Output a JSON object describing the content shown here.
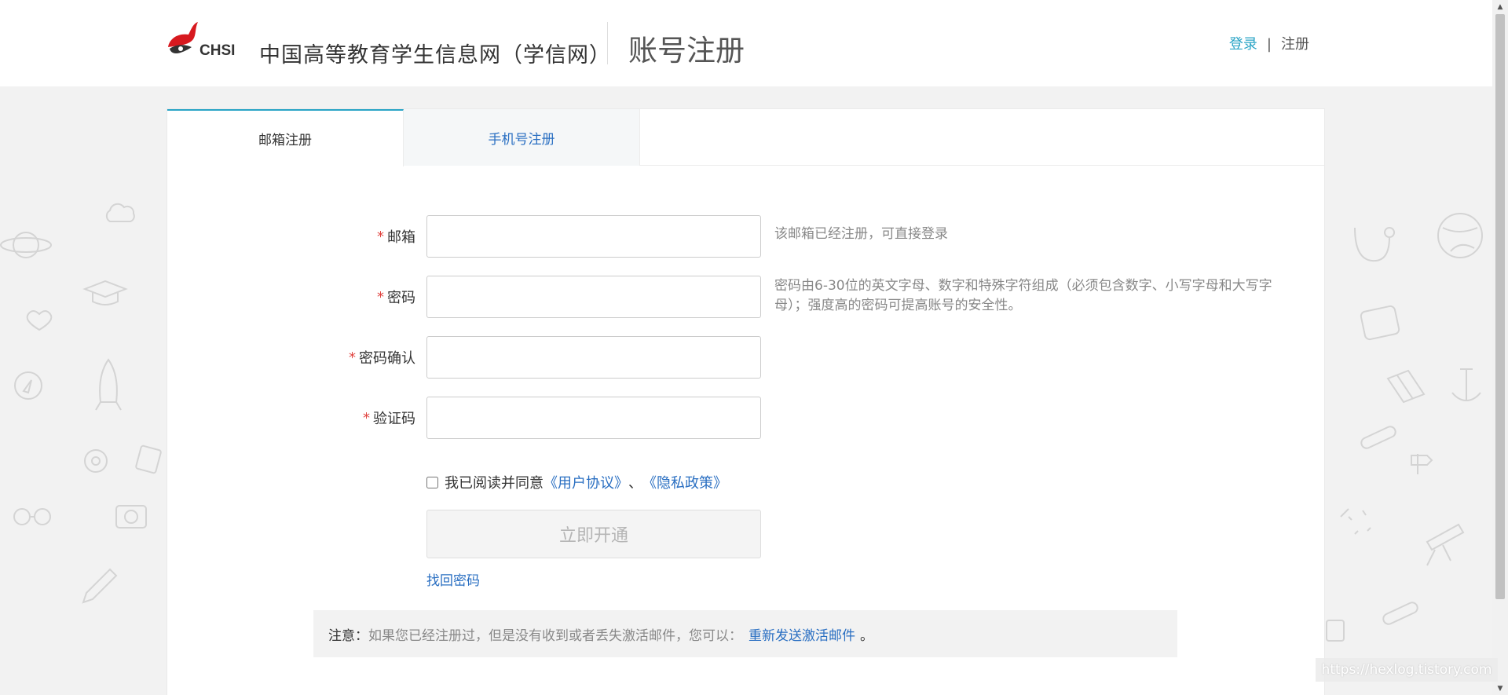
{
  "header": {
    "logo_text": "CHSI",
    "site_name": "中国高等教育学生信息网（学信网）",
    "page_title": "账号注册",
    "login_link": "登录",
    "separator": "|",
    "register_link": "注册"
  },
  "tabs": [
    {
      "label": "邮箱注册",
      "active": true
    },
    {
      "label": "手机号注册",
      "active": false
    }
  ],
  "form": {
    "required_mark": "*",
    "email": {
      "label": "邮箱",
      "value": "",
      "hint": "该邮箱已经注册，可直接登录"
    },
    "password": {
      "label": "密码",
      "value": "",
      "hint_line1": "密码由6-30位的英文字母、数字和特殊字符组成（必须包含数字、小写字母和大写字",
      "hint_line2": "母）；强度高的密码可提高账号的安全性。"
    },
    "password_confirm": {
      "label": "密码确认",
      "value": ""
    },
    "captcha": {
      "label": "验证码",
      "value": ""
    },
    "agree_text": "我已阅读并同意",
    "user_agreement": "《用户协议》",
    "agree_sep": "、",
    "privacy_policy": "《隐私政策》",
    "submit_label": "立即开通",
    "forgot_password": "找回密码"
  },
  "notice": {
    "label": "注意：",
    "text": "如果您已经注册过，但是没有收到或者丢失激活邮件，您可以：",
    "resend_link": "重新发送激活邮件",
    "end": "。"
  },
  "watermark": "https://hexlog.tistory.com",
  "colors": {
    "accent": "#2aa4c6",
    "link": "#2a6fc2",
    "required": "#e0433f",
    "logo_red": "#d7191f"
  }
}
